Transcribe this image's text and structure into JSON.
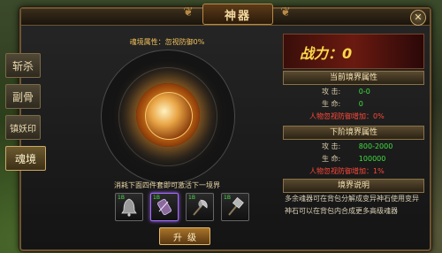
{
  "window": {
    "title": "神器",
    "close_glyph": "✕"
  },
  "tabs": [
    {
      "label": "斩杀",
      "active": false
    },
    {
      "label": "副骨",
      "active": false
    },
    {
      "label": "镇妖印",
      "active": false
    },
    {
      "label": "魂境",
      "active": true
    }
  ],
  "left": {
    "attribute_line": "魂境属性：忽视防御0%",
    "hint": "消耗下面四件套即可激活下一境界",
    "slots": [
      {
        "count": "1B",
        "icon": "bell-icon"
      },
      {
        "count": "1B",
        "icon": "scroll-icon"
      },
      {
        "count": "1B",
        "icon": "axe-icon"
      },
      {
        "count": "1B",
        "icon": "hammer-icon"
      }
    ],
    "upgrade_label": "升级"
  },
  "right": {
    "power": "战力：0",
    "current": {
      "header": "当前境界属性",
      "attack_label": "攻  击:",
      "attack_value": "0-0",
      "life_label": "生  命:",
      "life_value": "0",
      "ignore_defense": "人物忽视防御增加：0%"
    },
    "next": {
      "header": "下阶境界属性",
      "attack_label": "攻  击:",
      "attack_value": "800-2000",
      "life_label": "生  命:",
      "life_value": "100000",
      "ignore_defense": "人物忽视防御增加：1%"
    },
    "explain": {
      "header": "境界说明",
      "text": "多余魂器可在背包分解成变异神石使用变异神石可以在背包内合成更多高级魂器"
    }
  },
  "colors": {
    "accent_gold": "#f0c05a",
    "green": "#3fe040",
    "red": "#ff4a3a"
  }
}
